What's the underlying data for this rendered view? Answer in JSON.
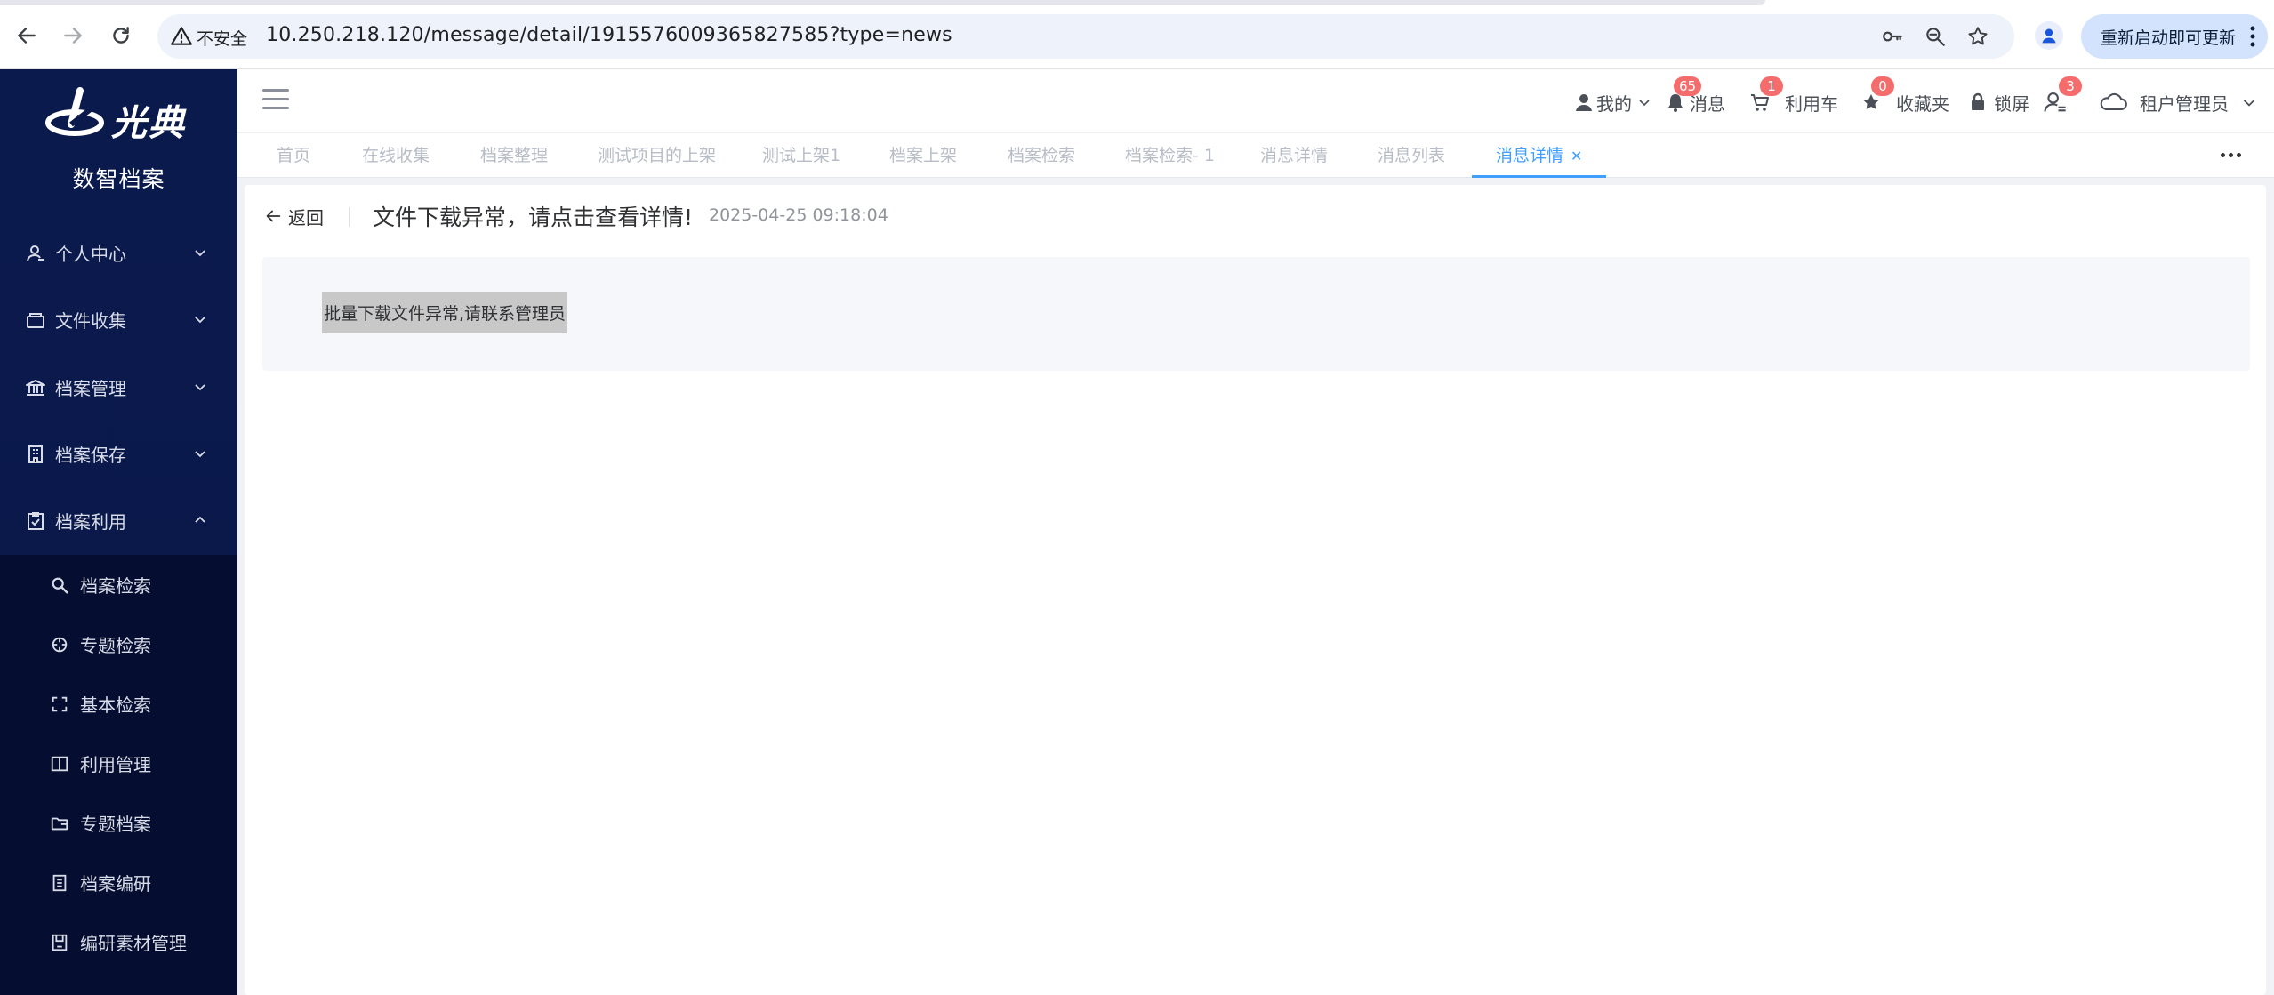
{
  "browser": {
    "security_label": "不安全",
    "url": "10.250.218.120/message/detail/1915576009365827585?type=news",
    "update_button": "重新启动即可更新"
  },
  "sidebar": {
    "logo_text": "光典",
    "app_name": "数智档案",
    "menu": [
      {
        "label": "个人中心",
        "icon": "user-icon",
        "expanded": false
      },
      {
        "label": "文件收集",
        "icon": "folder-icon",
        "expanded": false
      },
      {
        "label": "档案管理",
        "icon": "bank-icon",
        "expanded": false
      },
      {
        "label": "档案保存",
        "icon": "building-icon",
        "expanded": false
      },
      {
        "label": "档案利用",
        "icon": "checklist-icon",
        "expanded": true
      }
    ],
    "submenu": [
      {
        "label": "档案检索",
        "icon": "search-icon"
      },
      {
        "label": "专题检索",
        "icon": "crosshair-icon"
      },
      {
        "label": "基本检索",
        "icon": "scan-icon"
      },
      {
        "label": "利用管理",
        "icon": "book-icon"
      },
      {
        "label": "专题档案",
        "icon": "folder-open-icon"
      },
      {
        "label": "档案编研",
        "icon": "document-icon"
      },
      {
        "label": "编研素材管理",
        "icon": "save-icon"
      }
    ]
  },
  "header": {
    "mine": "我的",
    "messages": "消息",
    "messages_badge": "65",
    "cart": "利用车",
    "cart_badge": "1",
    "favorites": "收藏夹",
    "favorites_badge": "0",
    "lock": "锁屏",
    "users_badge": "3",
    "tenant": "租户管理员"
  },
  "tabs": [
    {
      "label": "首页",
      "active": false
    },
    {
      "label": "在线收集",
      "active": false
    },
    {
      "label": "档案整理",
      "active": false
    },
    {
      "label": "测试项目的上架",
      "active": false
    },
    {
      "label": "测试上架1",
      "active": false
    },
    {
      "label": "档案上架",
      "active": false
    },
    {
      "label": "档案检索",
      "active": false
    },
    {
      "label": "档案检索- 1",
      "active": false
    },
    {
      "label": "消息详情",
      "active": false
    },
    {
      "label": "消息列表",
      "active": false
    },
    {
      "label": "消息详情",
      "active": true
    }
  ],
  "message": {
    "back_label": "返回",
    "title": "文件下载异常，请点击查看详情!",
    "time": "2025-04-25 09:18:04",
    "body": "批量下载文件异常,请联系管理员"
  }
}
